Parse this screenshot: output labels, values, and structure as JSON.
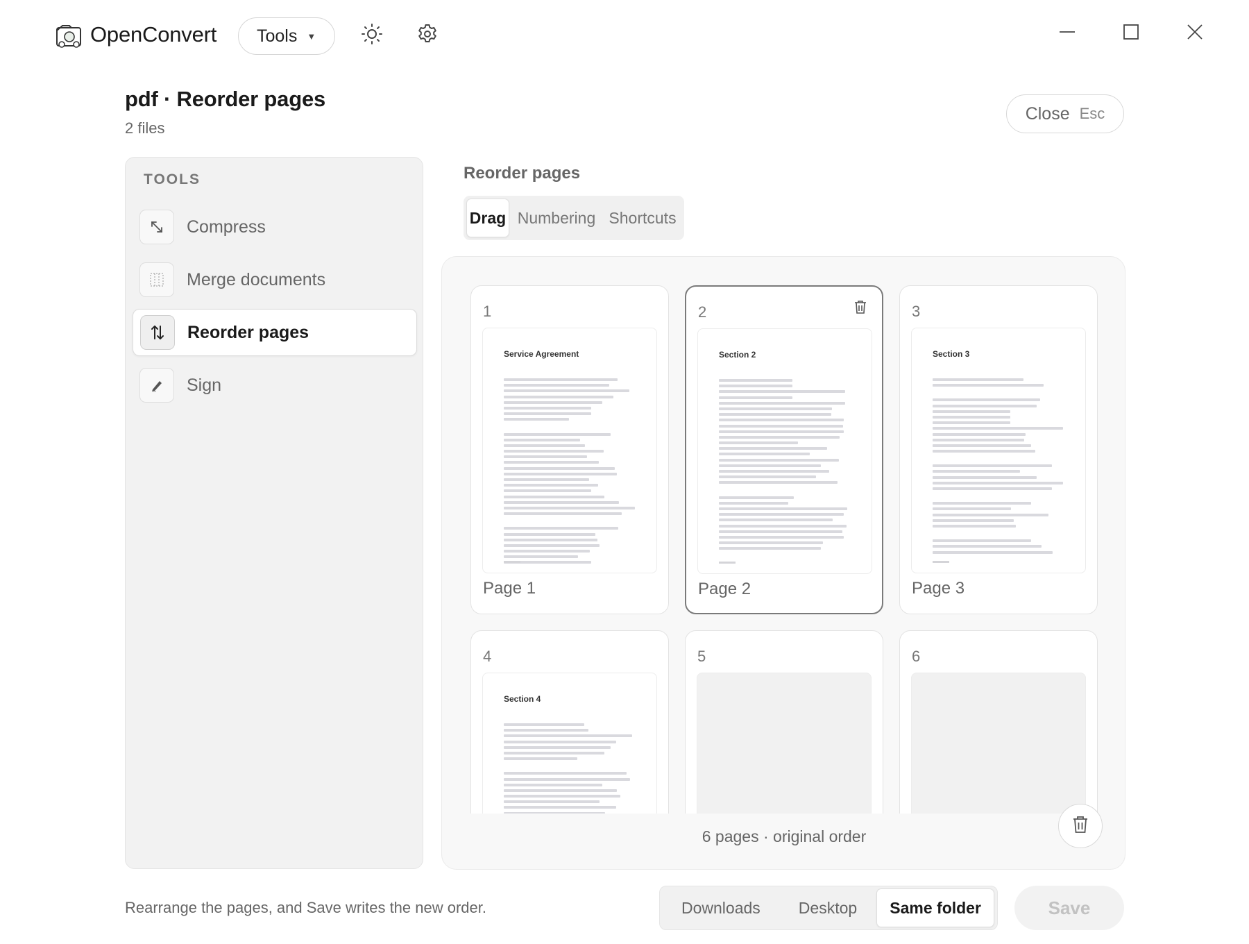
{
  "app": {
    "name": "OpenConvert",
    "tools_menu_label": "Tools"
  },
  "header": {
    "title": "pdf · Reorder pages",
    "subtitle": "2 files",
    "close_label": "Close",
    "close_shortcut": "Esc"
  },
  "sidebar": {
    "heading": "TOOLS",
    "items": [
      {
        "label": "Compress",
        "icon": "compress-icon",
        "active": false
      },
      {
        "label": "Merge documents",
        "icon": "merge-icon",
        "active": false
      },
      {
        "label": "Reorder pages",
        "icon": "reorder-icon",
        "active": true
      },
      {
        "label": "Sign",
        "icon": "pen-icon",
        "active": false
      }
    ]
  },
  "main": {
    "section_title": "Reorder pages",
    "tabs": [
      {
        "label": "Drag",
        "active": true
      },
      {
        "label": "Numbering",
        "active": false
      },
      {
        "label": "Shortcuts",
        "active": false
      }
    ],
    "pages": [
      {
        "number": "1",
        "caption": "Page 1",
        "thumb_title": "Service Agreement",
        "selected": false
      },
      {
        "number": "2",
        "caption": "Page 2",
        "thumb_title": "Section 2",
        "selected": true
      },
      {
        "number": "3",
        "caption": "Page 3",
        "thumb_title": "Section 3",
        "selected": false
      },
      {
        "number": "4",
        "caption": "",
        "thumb_title": "Section 4",
        "selected": false
      },
      {
        "number": "5",
        "caption": "",
        "thumb_title": "",
        "selected": false
      },
      {
        "number": "6",
        "caption": "",
        "thumb_title": "",
        "selected": false
      }
    ],
    "status": "6 pages · original order"
  },
  "footer": {
    "hint": "Rearrange the pages, and Save writes the new order.",
    "destinations": [
      {
        "label": "Downloads",
        "active": false
      },
      {
        "label": "Desktop",
        "active": false
      },
      {
        "label": "Same folder",
        "active": true
      }
    ],
    "save_label": "Save",
    "save_enabled": false
  },
  "colors": {
    "accent_text": "#1a1a1a",
    "muted_text": "#666666",
    "panel_bg": "#f2f2f2",
    "selected_border": "#7a7a7a"
  }
}
